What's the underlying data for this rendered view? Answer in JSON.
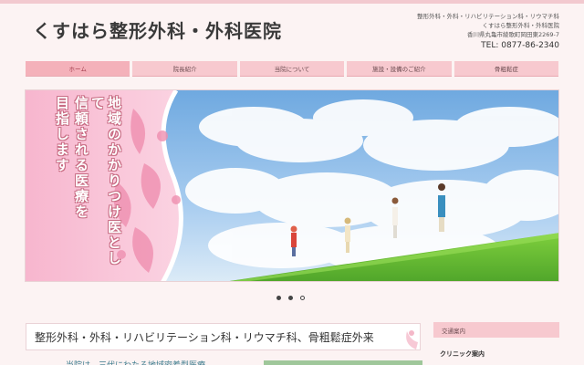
{
  "site": {
    "title": "くすはら整形外科・外科医院",
    "tagline": "整形外科・外科・リハビリテーション科・リウマチ科",
    "clinic_name": "くすはら整形外科・外科医院",
    "address": "香川県丸亀市綾歌町岡田東2269-7",
    "tel": "TEL: 0877-86-2340"
  },
  "nav": {
    "items": [
      {
        "label": "ホーム",
        "active": true
      },
      {
        "label": "院長紹介"
      },
      {
        "label": "当院について"
      },
      {
        "label": "施設・設備のご紹介"
      },
      {
        "label": "骨粗鬆症"
      }
    ]
  },
  "hero": {
    "slogan_line1": "地域のかかりつけ医として",
    "slogan_line2": "信頼される医療を",
    "slogan_line3": "目指します",
    "accent_color": "#f4b8c8"
  },
  "slider": {
    "dots": [
      "filled",
      "filled",
      "open"
    ]
  },
  "main": {
    "heading": "整形外科・外科・リハビリテーション科・リウマチ科、骨粗鬆症外来",
    "partial_text": "当院は、三代にわたる地域密着型医療"
  },
  "sidebar": {
    "heading": "交通案内",
    "subheading": "クリニック案内"
  },
  "colors": {
    "background": "#fcf3f3",
    "nav_pink": "#f7c9cf",
    "nav_active": "#f4b1ba"
  }
}
